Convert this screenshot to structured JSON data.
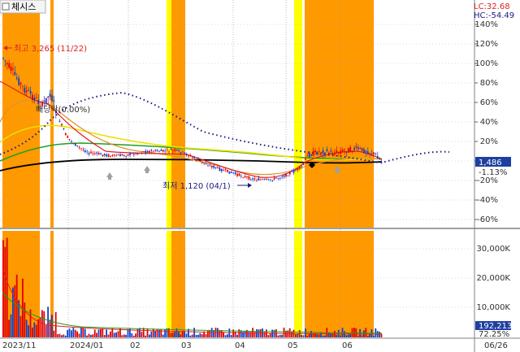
{
  "title_tab": "체시스",
  "info": {
    "lc": "LC:32.68",
    "hc": "HC:-54.49"
  },
  "annotations": {
    "high": "최고 3,265 (11/22)",
    "low": "최저 1,120 (04/1)",
    "mid": "배당락(0.00%)"
  },
  "price_axis": {
    "ticks": [
      "140%",
      "120%",
      "100%",
      "80%",
      "60%",
      "40%",
      "20%",
      "0%",
      "-20%",
      "-40%",
      "-60%"
    ],
    "current_value": "1,486",
    "current_change": "-1.13%"
  },
  "volume_axis": {
    "ticks": [
      "30,000K",
      "20,000K",
      "10,000K"
    ],
    "current_value": "192,213",
    "current_pct": "72.25%"
  },
  "date_axis": [
    "2023/11",
    "2024/01",
    "02",
    "03",
    "04",
    "05",
    "06",
    "06/26"
  ],
  "colors": {
    "shade_orange": "#FF9900",
    "shade_yellow": "#FFFF00",
    "candle_up": "#E00000",
    "candle_down": "#1040D0",
    "ma_black": "#000000",
    "ma_green": "#20A020",
    "ma_yellow": "#F0E000",
    "ma_orange": "#E09030",
    "ma_red": "#E02020",
    "dotted": "#1A1A80"
  },
  "chart_data": {
    "type": "line",
    "series": [
      {
        "x": [
          "2023-11-22",
          "2023-12-05",
          "2023-12-20",
          "2024-01-05",
          "2024-01-20",
          "2024-02-05",
          "2024-02-20",
          "2024-03-05",
          "2024-03-20",
          "2024-04-01",
          "2024-04-15",
          "2024-05-01",
          "2024-05-15",
          "2024-06-01",
          "2024-06-15",
          "2024-06-20"
        ],
        "values": [
          3265,
          2500,
          2200,
          1700,
          1550,
          1500,
          1600,
          1550,
          1350,
          1200,
          1150,
          1350,
          1550,
          1600,
          1620,
          1486
        ]
      }
    ],
    "ylabel": "",
    "ylim": [
      -60,
      140
    ]
  }
}
